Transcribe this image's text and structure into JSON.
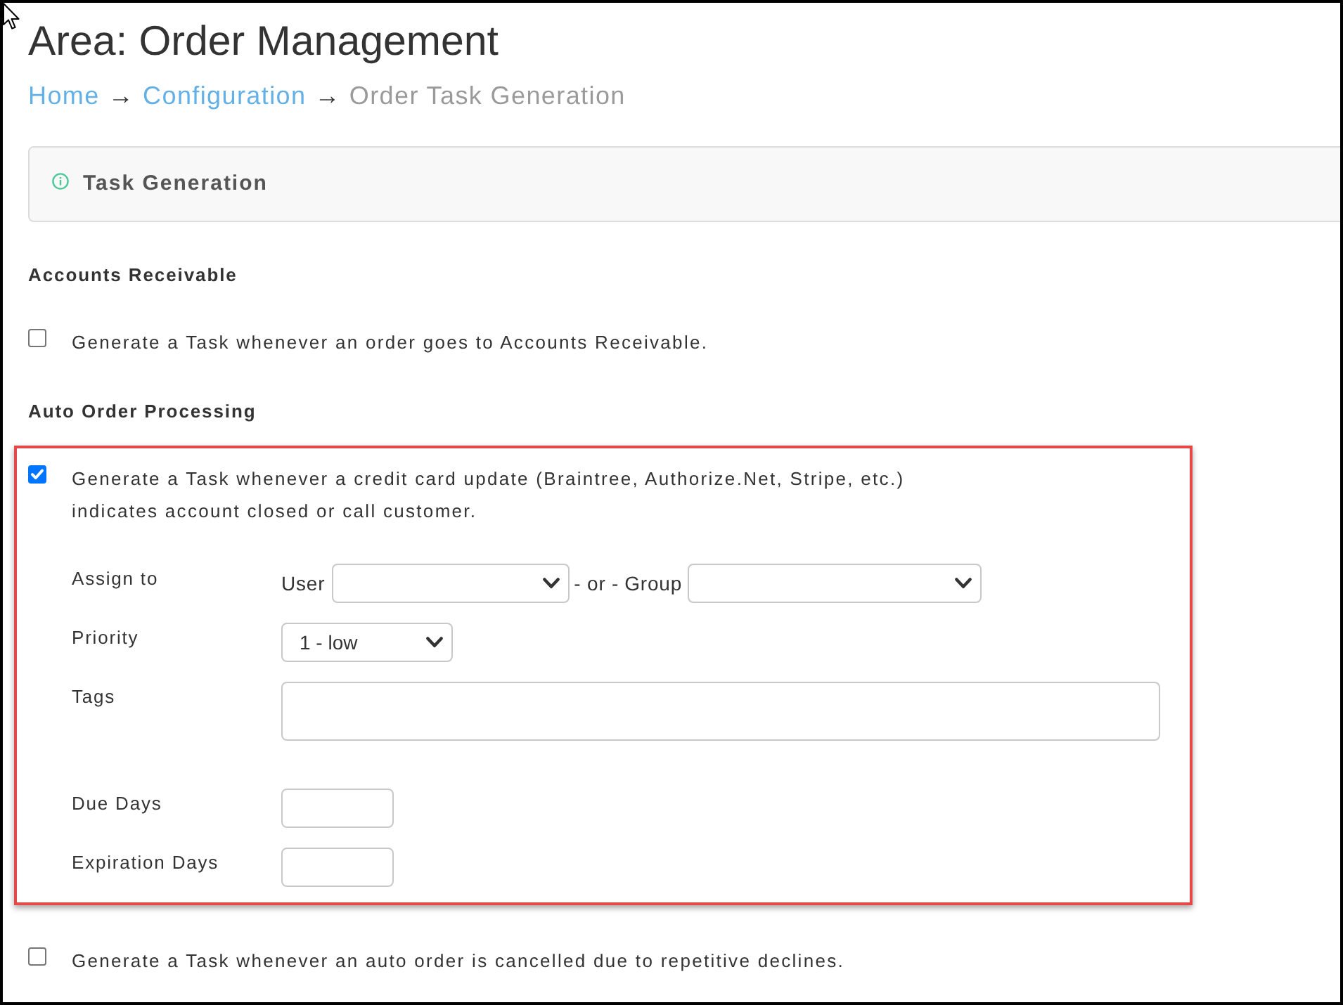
{
  "page": {
    "title": "Area: Order Management"
  },
  "breadcrumb": [
    {
      "label": "Home",
      "kind": "link",
      "separator": "→"
    },
    {
      "label": "Configuration",
      "kind": "link",
      "separator": "→"
    },
    {
      "label": "Order Task Generation",
      "kind": "current"
    }
  ],
  "panel": {
    "title": "Task Generation"
  },
  "sections": [
    {
      "heading": "Accounts Receivable",
      "options": [
        {
          "label": "Generate a Task whenever an order goes to Accounts Receivable.",
          "checked": false,
          "highlighted": false
        }
      ]
    },
    {
      "heading": "Auto Order Processing",
      "options": [
        {
          "label": "Generate a Task whenever a credit card update (Braintree, Authorize.Net, Stripe, etc.) indicates account closed or call customer.",
          "checked": true,
          "highlighted": true,
          "fields": [
            {
              "kind": "assign",
              "label": "Assign to",
              "user_label": "User",
              "or_text": "- or -",
              "group_label": "Group"
            },
            {
              "kind": "select",
              "label": "Priority",
              "value": "1 - low"
            },
            {
              "kind": "textarea",
              "label": "Tags"
            },
            {
              "kind": "number",
              "label": "Due Days"
            },
            {
              "kind": "number",
              "label": "Expiration Days"
            }
          ]
        },
        {
          "label": "Generate a Task whenever an auto order is cancelled due to repetitive declines.",
          "checked": false,
          "highlighted": false
        }
      ]
    }
  ]
}
